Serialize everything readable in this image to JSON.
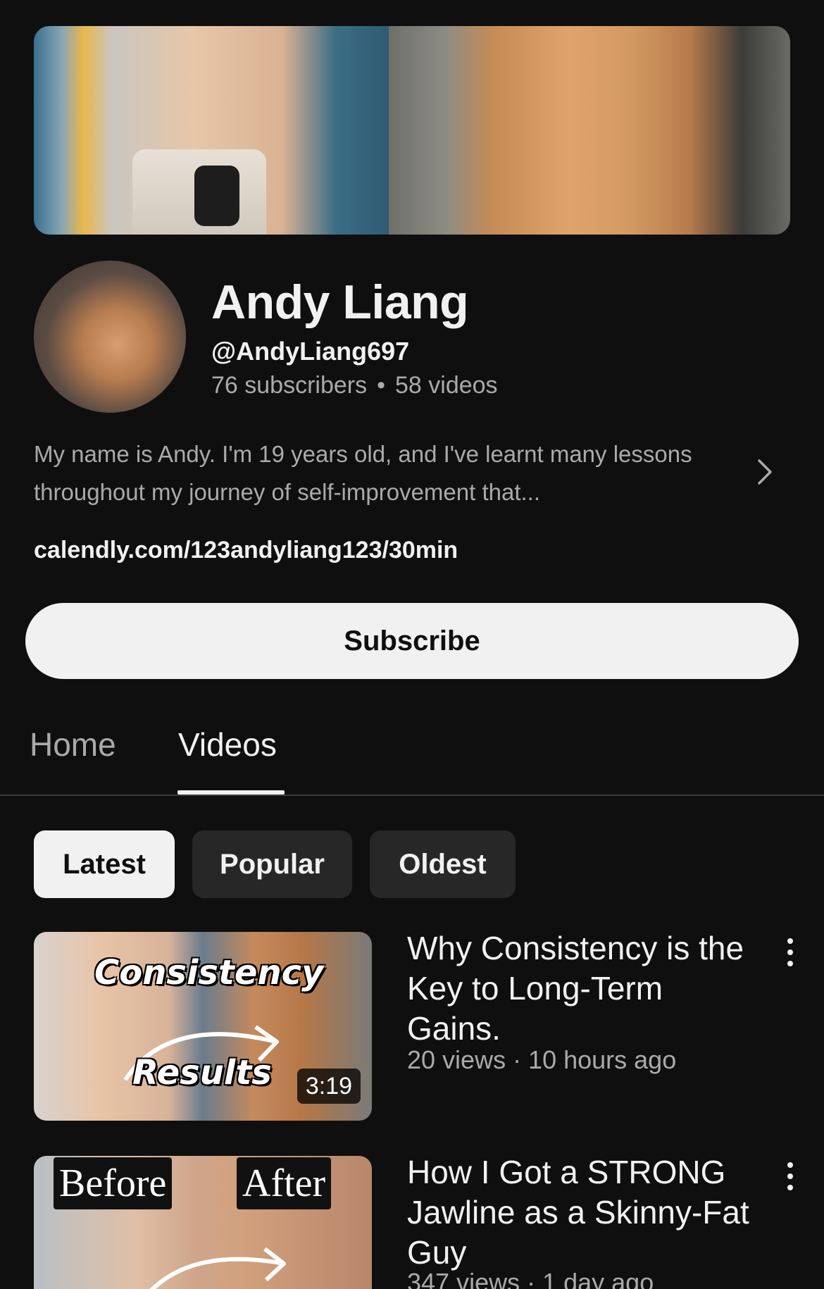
{
  "channel": {
    "name": "Andy Liang",
    "handle": "@AndyLiang697",
    "subscribers": "76 subscribers",
    "separator": "•",
    "videos_count": "58 videos",
    "description": "My name is Andy. I'm 19 years old, and I've learnt many lessons throughout my journey of self-improvement that...",
    "link": "calendly.com/123andyliang123/30min"
  },
  "actions": {
    "subscribe_label": "Subscribe"
  },
  "tabs": [
    {
      "label": "Home",
      "active": false
    },
    {
      "label": "Videos",
      "active": true
    }
  ],
  "filters": [
    {
      "label": "Latest",
      "selected": true
    },
    {
      "label": "Popular",
      "selected": false
    },
    {
      "label": "Oldest",
      "selected": false
    }
  ],
  "videos": [
    {
      "title": "Why Consistency is the Key to Long-Term Gains.",
      "meta": "20 views · 10 hours ago",
      "duration": "3:19",
      "thumb_text_top": "Consistency",
      "thumb_text_bottom": "Results"
    },
    {
      "title": "How I Got a STRONG Jawline as a Skinny-Fat Guy",
      "meta": "347 views · 1 day ago",
      "thumb_label_left": "Before",
      "thumb_label_right": "After"
    }
  ],
  "icons": {
    "description_expand": "chevron-right-icon",
    "video_menu": "more-vert-icon"
  },
  "colors": {
    "background": "#0f0f0f",
    "text_primary": "#f1f1f1",
    "text_secondary": "#aaaaaa",
    "chip_bg": "#272727"
  }
}
